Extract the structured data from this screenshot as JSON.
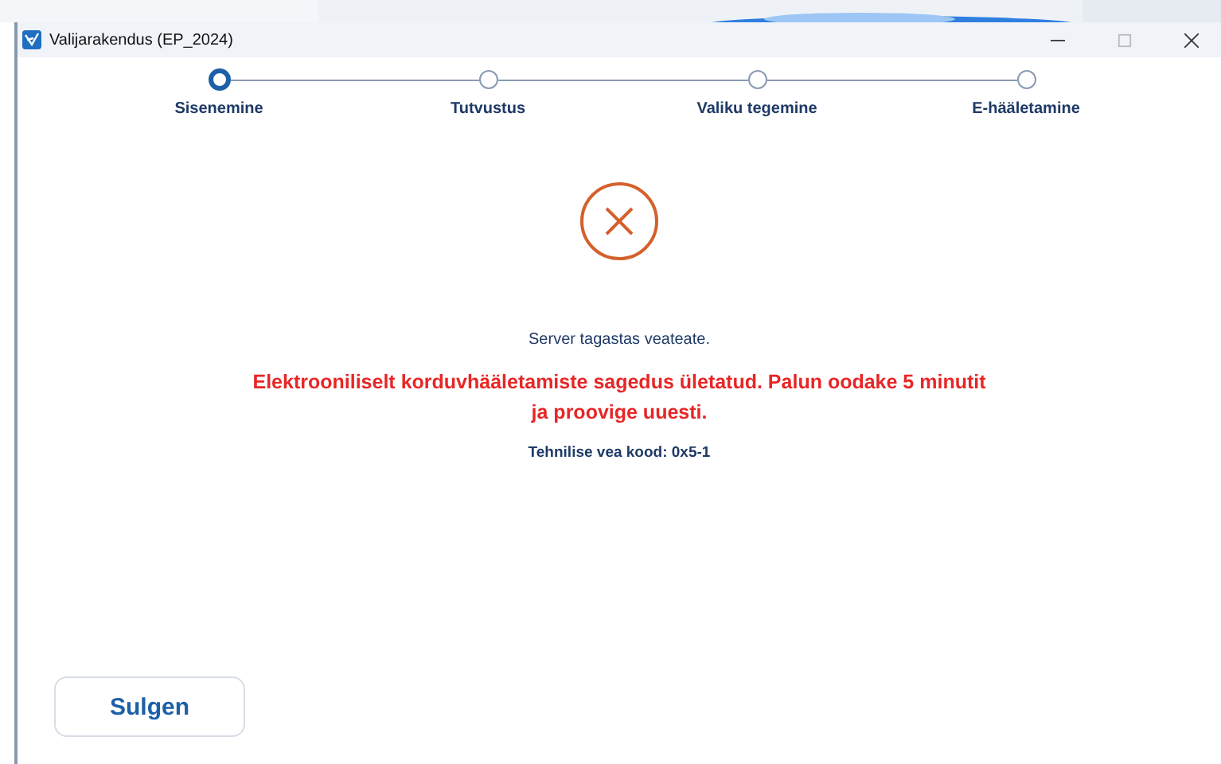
{
  "window": {
    "title": "Valijarakendus (EP_2024)"
  },
  "steps": [
    {
      "label": "Sisenemine",
      "selected": true
    },
    {
      "label": "Tutvustus",
      "selected": false
    },
    {
      "label": "Valiku tegemine",
      "selected": false
    },
    {
      "label": "E-hääletamine",
      "selected": false
    }
  ],
  "message": {
    "title": "Server tagastas veateate.",
    "error": "Elektrooniliselt korduvhääletamiste sagedus ületatud. Palun oodake 5 minutit ja proovige uuesti.",
    "code": "Tehnilise vea kood: 0x5-1"
  },
  "buttons": [
    "Sulgen"
  ]
}
